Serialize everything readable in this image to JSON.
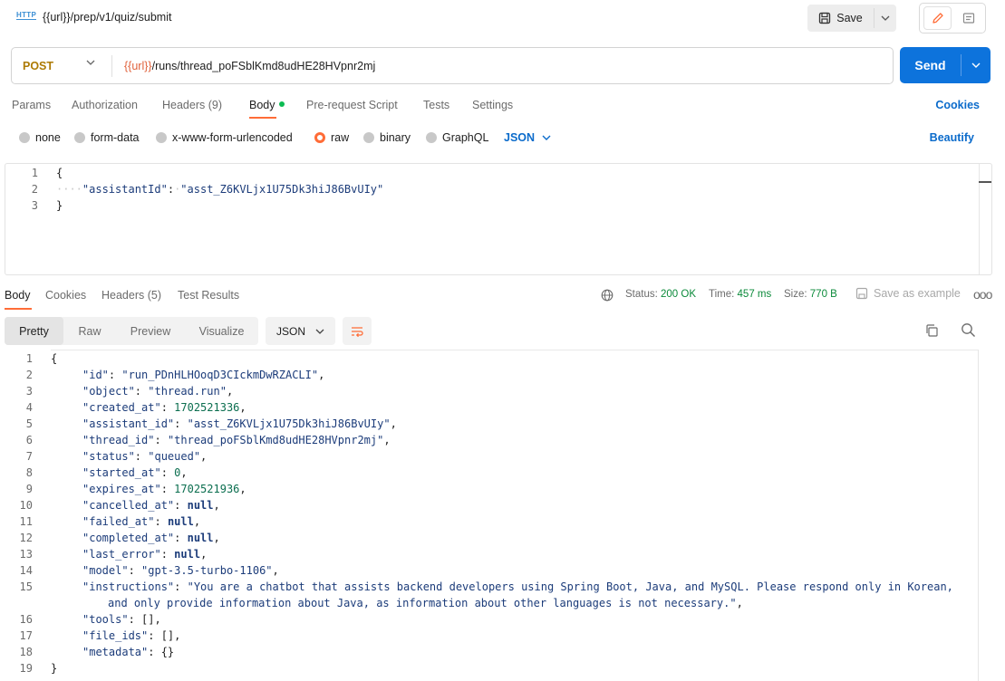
{
  "header": {
    "request_title": "{{url}}/prep/v1/quiz/submit",
    "http_icon_text": "HTTP",
    "save_label": "Save"
  },
  "request": {
    "method": "POST",
    "url_variable": "{{url}}",
    "url_path": "/runs/thread_poFSblKmd8udHE28HVpnr2mj",
    "send_label": "Send"
  },
  "request_tabs": {
    "params": "Params",
    "authorization": "Authorization",
    "headers": "Headers (9)",
    "body": "Body",
    "prerequest": "Pre-request Script",
    "tests": "Tests",
    "settings": "Settings",
    "cookies": "Cookies"
  },
  "body_types": {
    "none": "none",
    "form_data": "form-data",
    "urlencoded": "x-www-form-urlencoded",
    "raw": "raw",
    "binary": "binary",
    "graphql": "GraphQL",
    "selected_format": "JSON",
    "beautify": "Beautify"
  },
  "request_body": {
    "line1": "{",
    "line2_ws": "····",
    "line2_key": "\"assistantId\"",
    "line2_colon": ":",
    "line2_ws2": "·",
    "line2_value": "\"asst_Z6KVLjx1U75Dk3hiJ86BvUIy\"",
    "line3": "}"
  },
  "response_tabs": {
    "body": "Body",
    "cookies": "Cookies",
    "headers": "Headers (5)",
    "test_results": "Test Results",
    "status_label": "Status:",
    "status_value": "200 OK",
    "time_label": "Time:",
    "time_value": "457 ms",
    "size_label": "Size:",
    "size_value": "770 B",
    "save_example": "Save as example",
    "more": "ooo"
  },
  "response_view": {
    "pretty": "Pretty",
    "raw": "Raw",
    "preview": "Preview",
    "visualize": "Visualize",
    "format": "JSON"
  },
  "response_body": {
    "l1": "{",
    "l2k": "\"id\"",
    "l2v": "\"run_PDnHLHOoqD3CIckmDwRZACLI\"",
    "l3k": "\"object\"",
    "l3v": "\"thread.run\"",
    "l4k": "\"created_at\"",
    "l4v": "1702521336",
    "l5k": "\"assistant_id\"",
    "l5v": "\"asst_Z6KVLjx1U75Dk3hiJ86BvUIy\"",
    "l6k": "\"thread_id\"",
    "l6v": "\"thread_poFSblKmd8udHE28HVpnr2mj\"",
    "l7k": "\"status\"",
    "l7v": "\"queued\"",
    "l8k": "\"started_at\"",
    "l8v": "0",
    "l9k": "\"expires_at\"",
    "l9v": "1702521936",
    "l10k": "\"cancelled_at\"",
    "l10v": "null",
    "l11k": "\"failed_at\"",
    "l11v": "null",
    "l12k": "\"completed_at\"",
    "l12v": "null",
    "l13k": "\"last_error\"",
    "l13v": "null",
    "l14k": "\"model\"",
    "l14v": "\"gpt-3.5-turbo-1106\"",
    "l15k": "\"instructions\"",
    "l15v_a": "\"You are a chatbot that assists backend developers using Spring Boot, Java, and MySQL. Please respond only in Korean,",
    "l15v_b": "and only provide information about Java, as information about other languages is not necessary.\"",
    "l16k": "\"tools\"",
    "l16v": "[]",
    "l17k": "\"file_ids\"",
    "l17v": "[]",
    "l18k": "\"metadata\"",
    "l18v": "{}",
    "l19": "}"
  },
  "colors": {
    "accent_orange": "#ff6c37",
    "send_blue": "#0d73dc",
    "link_blue": "#0b6bcb",
    "status_green": "#0b8a3a",
    "method_post": "#ad7a03"
  }
}
